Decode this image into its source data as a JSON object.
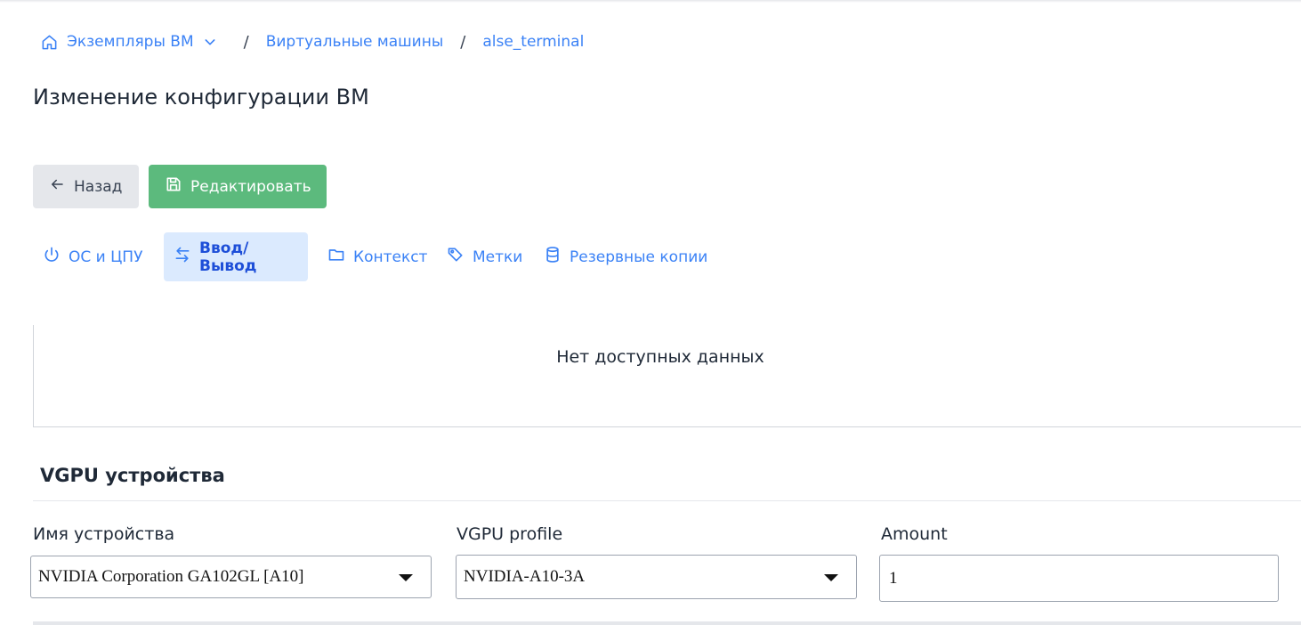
{
  "breadcrumb": {
    "items": [
      {
        "label": "Экземпляры ВМ",
        "icon": "home-icon",
        "has_dropdown": true
      },
      {
        "label": "Виртуальные машины"
      },
      {
        "label": "alse_terminal"
      }
    ],
    "separator": "/"
  },
  "page": {
    "title": "Изменение конфигурации ВМ"
  },
  "toolbar": {
    "back_label": "Назад",
    "edit_label": "Редактировать"
  },
  "tabs": [
    {
      "label": "ОС и ЦПУ",
      "icon": "power-icon",
      "active": false
    },
    {
      "label": "Ввод/Вывод",
      "icon": "arrows-left-right-icon",
      "active": true
    },
    {
      "label": "Контекст",
      "icon": "folder-icon",
      "active": false
    },
    {
      "label": "Метки",
      "icon": "tags-icon",
      "active": false
    },
    {
      "label": "Резервные копии",
      "icon": "database-icon",
      "active": false
    }
  ],
  "io_panel": {
    "empty_text": "Нет доступных данных"
  },
  "vgpu": {
    "title": "VGPU устройства",
    "device_label": "Имя устройства",
    "device_value": "NVIDIA Corporation GA102GL [A10]",
    "profile_label": "VGPU profile",
    "profile_value": "NVIDIA-A10-3A",
    "amount_label": "Amount",
    "amount_value": "1"
  },
  "colors": {
    "accent": "#3b82f6",
    "success": "#5cba7d",
    "active_tab_bg": "#dbeafe",
    "secondary_button": "#e5e7eb"
  }
}
